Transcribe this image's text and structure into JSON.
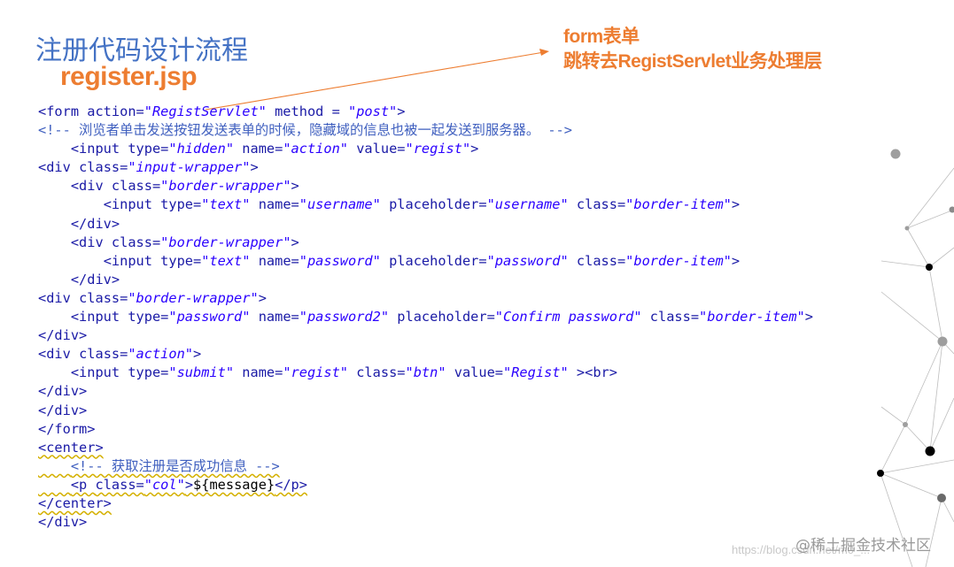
{
  "slide": {
    "title": "注册代码设计流程",
    "subtitle": "register.jsp",
    "annotation_line1": "form表单",
    "annotation_line2": "跳转去RegistServlet业务处理层"
  },
  "code_lines": [
    [
      [
        "tag",
        "<form "
      ],
      [
        "attr",
        "action="
      ],
      [
        "val",
        "\"RegistServlet\""
      ],
      [
        "attr",
        " method = "
      ],
      [
        "val",
        "\"post\""
      ],
      [
        "tag",
        ">"
      ]
    ],
    [
      [
        "comment",
        "<!-- 浏览者单击发送按钮发送表单的时候，隐藏域的信息也被一起发送到服务器。 -->"
      ]
    ],
    [
      [
        "plain",
        "    "
      ],
      [
        "tag",
        "<input "
      ],
      [
        "attr",
        "type="
      ],
      [
        "val",
        "\"hidden\""
      ],
      [
        "attr",
        " name="
      ],
      [
        "val",
        "\"action\""
      ],
      [
        "attr",
        " value="
      ],
      [
        "val",
        "\"regist\""
      ],
      [
        "tag",
        ">"
      ]
    ],
    [
      [
        "tag",
        "<div "
      ],
      [
        "attr",
        "class="
      ],
      [
        "val",
        "\"input-wrapper\""
      ],
      [
        "tag",
        ">"
      ]
    ],
    [
      [
        "plain",
        "    "
      ],
      [
        "tag",
        "<div "
      ],
      [
        "attr",
        "class="
      ],
      [
        "val",
        "\"border-wrapper\""
      ],
      [
        "tag",
        ">"
      ]
    ],
    [
      [
        "plain",
        "        "
      ],
      [
        "tag",
        "<input "
      ],
      [
        "attr",
        "type="
      ],
      [
        "val",
        "\"text\""
      ],
      [
        "attr",
        " name="
      ],
      [
        "val",
        "\"username\""
      ],
      [
        "attr",
        " placeholder="
      ],
      [
        "val",
        "\"username\""
      ],
      [
        "attr",
        " class="
      ],
      [
        "val",
        "\"border-item\""
      ],
      [
        "tag",
        ">"
      ]
    ],
    [
      [
        "plain",
        "    "
      ],
      [
        "tag",
        "</div>"
      ]
    ],
    [
      [
        "plain",
        "    "
      ],
      [
        "tag",
        "<div "
      ],
      [
        "attr",
        "class="
      ],
      [
        "val",
        "\"border-wrapper\""
      ],
      [
        "tag",
        ">"
      ]
    ],
    [
      [
        "plain",
        "        "
      ],
      [
        "tag",
        "<input "
      ],
      [
        "attr",
        "type="
      ],
      [
        "val",
        "\"text\""
      ],
      [
        "attr",
        " name="
      ],
      [
        "val",
        "\"password\""
      ],
      [
        "attr",
        " placeholder="
      ],
      [
        "val",
        "\"password\""
      ],
      [
        "attr",
        " class="
      ],
      [
        "val",
        "\"border-item\""
      ],
      [
        "tag",
        ">"
      ]
    ],
    [
      [
        "plain",
        "    "
      ],
      [
        "tag",
        "</div>"
      ]
    ],
    [
      [
        "tag",
        "<div "
      ],
      [
        "attr",
        "class="
      ],
      [
        "val",
        "\"border-wrapper\""
      ],
      [
        "tag",
        ">"
      ]
    ],
    [
      [
        "plain",
        "    "
      ],
      [
        "tag",
        "<input "
      ],
      [
        "attr",
        "type="
      ],
      [
        "val",
        "\"password\""
      ],
      [
        "attr",
        " name="
      ],
      [
        "val",
        "\"password2\""
      ],
      [
        "attr",
        " placeholder="
      ],
      [
        "val",
        "\"Confirm password\""
      ],
      [
        "attr",
        " class="
      ],
      [
        "val",
        "\"border-item\""
      ],
      [
        "tag",
        ">"
      ]
    ],
    [
      [
        "tag",
        "</div>"
      ]
    ],
    [
      [
        "tag",
        "<div "
      ],
      [
        "attr",
        "class="
      ],
      [
        "val",
        "\"action\""
      ],
      [
        "tag",
        ">"
      ]
    ],
    [
      [
        "plain",
        "    "
      ],
      [
        "tag",
        "<input "
      ],
      [
        "attr",
        "type="
      ],
      [
        "val",
        "\"submit\""
      ],
      [
        "attr",
        " name="
      ],
      [
        "val",
        "\"regist\""
      ],
      [
        "attr",
        " class="
      ],
      [
        "val",
        "\"btn\""
      ],
      [
        "attr",
        " value="
      ],
      [
        "val",
        "\"Regist\""
      ],
      [
        "tag",
        " ><br>"
      ]
    ],
    [
      [
        "tag",
        "</div>"
      ]
    ],
    [
      [
        "tag",
        "</div>"
      ]
    ],
    [
      [
        "tag",
        "</form>"
      ]
    ],
    [
      [
        "tag",
        "<center>"
      ]
    ],
    [
      [
        "plain",
        "    "
      ],
      [
        "comment",
        "<!-- 获取注册是否成功信息 -->"
      ]
    ],
    [
      [
        "plain",
        "    "
      ],
      [
        "tag",
        "<p "
      ],
      [
        "attr",
        "class="
      ],
      [
        "val",
        "\"col\""
      ],
      [
        "tag",
        ">"
      ],
      [
        "plain",
        "${message}"
      ],
      [
        "tag",
        "</p>"
      ]
    ],
    [
      [
        "tag",
        "</center>"
      ]
    ],
    [
      [
        "tag",
        "</div>"
      ]
    ]
  ],
  "squiggle_lines": [
    18,
    19,
    20,
    21
  ],
  "footer": {
    "watermark": "@稀土掘金技术社区",
    "url": "https://blog.csdn.net/m0_..."
  },
  "colors": {
    "title": "#4472c4",
    "accent": "#ed7d31",
    "code_tag": "#1a1aa6",
    "code_value": "#2a00ff"
  }
}
